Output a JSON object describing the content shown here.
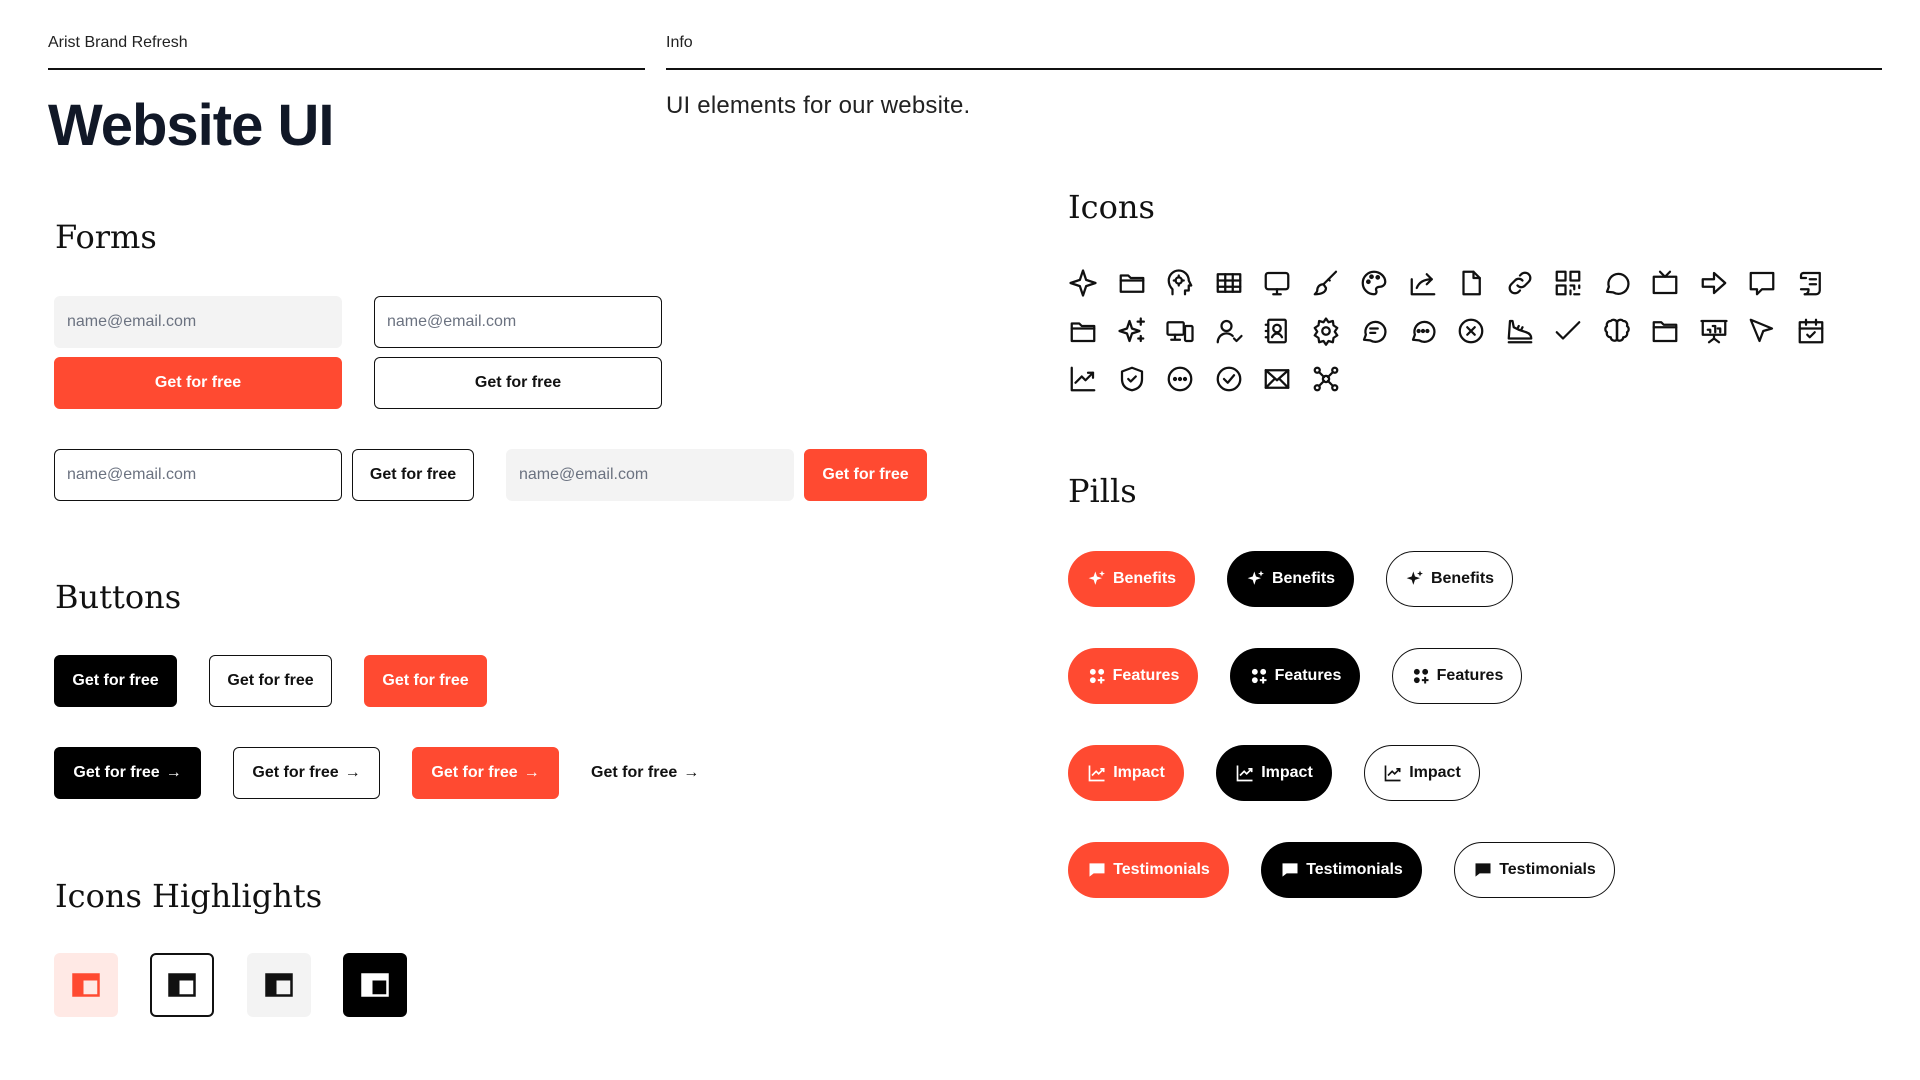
{
  "header": {
    "project_label": "Arist Brand Refresh",
    "info_label": "Info",
    "title": "Website UI",
    "info_text": "UI elements for our website."
  },
  "forms": {
    "heading": "Forms",
    "email_placeholder": "name@email.com",
    "cta_label": "Get for free"
  },
  "buttons": {
    "heading": "Buttons",
    "label": "Get for free",
    "arrow": "→"
  },
  "icons_highlights": {
    "heading": "Icons Highlights"
  },
  "icons": {
    "heading": "Icons",
    "names": [
      [
        "sparkle-icon",
        "folder-icon",
        "head-gear-icon",
        "table-icon",
        "monitor-icon",
        "brush-icon",
        "palette-icon",
        "share-icon",
        "document-icon",
        "link-icon",
        "qr-code-icon",
        "chat-bubble-icon",
        "tv-icon",
        "arrow-right-icon",
        "message-square-icon",
        "scroll-icon"
      ],
      [
        "folder-open-icon",
        "sparkles-icon",
        "devices-icon",
        "user-check-icon",
        "contact-card-icon",
        "settings-icon",
        "chat-lines-icon",
        "chat-dots-icon",
        "close-circle-icon",
        "sneaker-icon",
        "checkmark-icon",
        "brain-icon",
        "folder-alt-icon",
        "presentation-icon",
        "cursor-icon",
        "calendar-check-icon"
      ],
      [
        "trend-chart-icon",
        "shield-check-icon",
        "dots-circle-icon",
        "check-circle-icon",
        "mail-icon",
        "network-icon"
      ]
    ]
  },
  "pills": {
    "heading": "Pills",
    "rows": [
      {
        "label": "Benefits",
        "icon": "sparkles-icon"
      },
      {
        "label": "Features",
        "icon": "grid-plus-icon"
      },
      {
        "label": "Impact",
        "icon": "trend-chart-icon"
      },
      {
        "label": "Testimonials",
        "icon": "message-icon"
      }
    ]
  },
  "colors": {
    "accent": "#ff4a31",
    "dark": "#000000",
    "light_fill": "#f3f3f3",
    "accent_tint": "#ffe9e5"
  }
}
